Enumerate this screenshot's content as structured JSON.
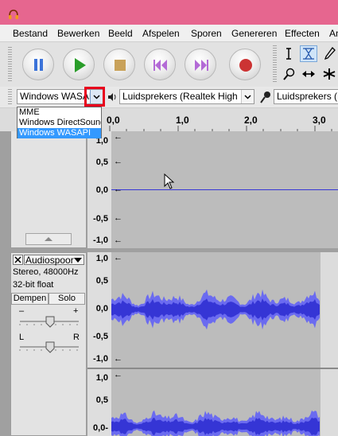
{
  "menu": [
    "Bestand",
    "Bewerken",
    "Beeld",
    "Afspelen",
    "Sporen",
    "Genereren",
    "Effecten",
    "An"
  ],
  "transport": {
    "pause_color": "#3b73d9",
    "play_color": "#2a9d2a",
    "stop_color": "#c9a25a",
    "skip_color": "#b36ad6",
    "record_color": "#cc3333"
  },
  "devices": {
    "host_selected": "Windows WASAPI",
    "host_options": [
      "MME",
      "Windows DirectSound",
      "Windows WASAPI"
    ],
    "playback_device": "Luidsprekers (Realtek High Def",
    "recording_device": "Luidsprekers (Realte"
  },
  "timeline": {
    "ticks": [
      "0,0",
      "1,0",
      "2,0",
      "3,0"
    ]
  },
  "track1": {
    "ruler_labels": [
      "1,0",
      "0,5",
      "0,0",
      "-0,5",
      "-1,0"
    ]
  },
  "track2": {
    "name": "Audiospoor",
    "info_rate": "Stereo, 48000Hz",
    "info_format": "32-bit float",
    "mute_label": "Dempen",
    "solo_label": "Solo",
    "gain_minus": "–",
    "gain_plus": "+",
    "pan_left": "L",
    "pan_right": "R",
    "ruler_labels": [
      "1,0",
      "0,5",
      "0,0",
      "-0,5",
      "-1,0"
    ],
    "ruler2_labels": [
      "1,0",
      "0,5",
      "0,0-"
    ]
  },
  "colors": {
    "waveform": "#3535d5",
    "waveform_light": "#6b6bf0",
    "titlebar": "#e6668f",
    "highlight": "#e8001c"
  }
}
